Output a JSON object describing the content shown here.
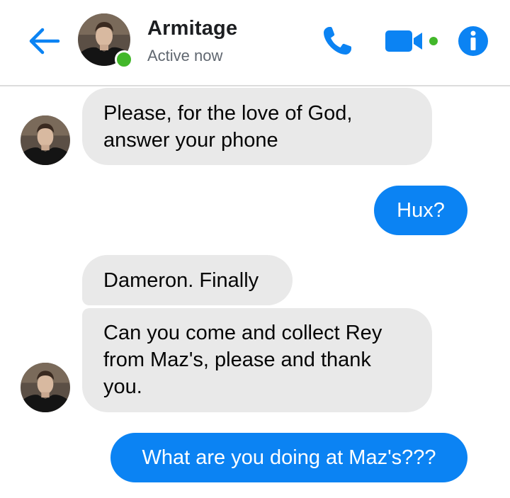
{
  "header": {
    "contact_name": "Armitage",
    "status": "Active now",
    "online": true,
    "icons": {
      "back": "back-arrow-icon",
      "call": "phone-icon",
      "video": "video-camera-icon",
      "info": "info-icon"
    },
    "accent_color": "#0b83f3",
    "online_color": "#42b72a"
  },
  "messages": [
    {
      "sender": "contact",
      "text_lines": [
        "Please, for the love of God,",
        "answer your phone"
      ]
    },
    {
      "sender": "me",
      "text_lines": [
        "Hux?"
      ]
    },
    {
      "sender": "contact",
      "text_lines": [
        "Dameron. Finally"
      ]
    },
    {
      "sender": "contact",
      "text_lines": [
        "Can you come and collect Rey",
        "from Maz's, please and thank",
        "you."
      ]
    },
    {
      "sender": "me",
      "text_lines": [
        "What are you doing at Maz's???"
      ]
    }
  ]
}
